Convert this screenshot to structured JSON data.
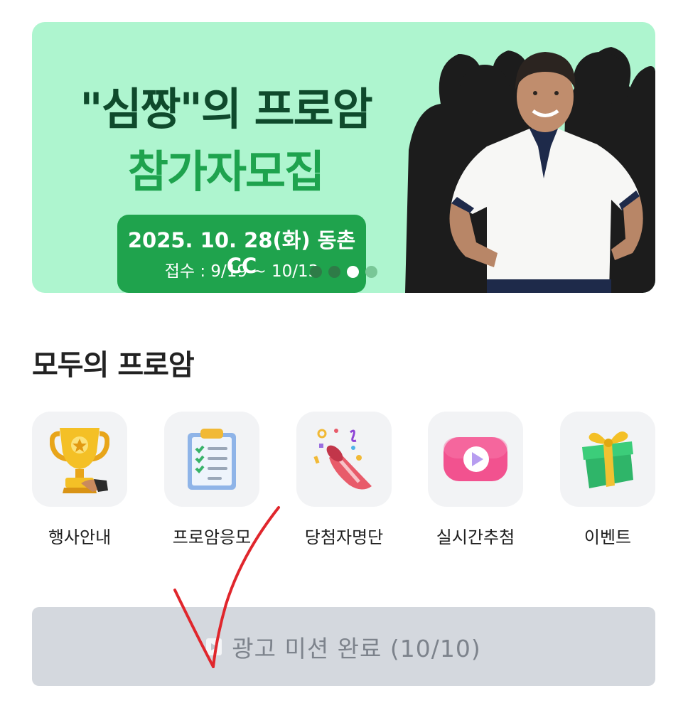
{
  "banner": {
    "title_line1": "\"심짱\"의 프로암",
    "title_line2": "참가자모집",
    "date_line": "2025. 10. 28(화) 동촌CC",
    "period_line": "접수 : 9/19 ~ 10/13",
    "carousel": {
      "total": 4,
      "active_index": 2
    },
    "colors": {
      "background": "#aef5cf",
      "title_dark": "#0f4a2c",
      "title_green": "#1ea34e",
      "date_box": "#1fa34d"
    }
  },
  "section": {
    "title": "모두의 프로암"
  },
  "menu": [
    {
      "label": "행사안내",
      "icon": "trophy-icon"
    },
    {
      "label": "프로암응모",
      "icon": "clipboard-checklist-icon"
    },
    {
      "label": "당첨자명단",
      "icon": "party-popper-icon"
    },
    {
      "label": "실시간추첨",
      "icon": "play-button-icon"
    },
    {
      "label": "이벤트",
      "icon": "gift-box-icon"
    }
  ],
  "mission_button": {
    "label": "광고 미션 완료 (10/10)",
    "icon": "play-icon"
  },
  "annotation": {
    "stroke_color": "#e0262c"
  }
}
